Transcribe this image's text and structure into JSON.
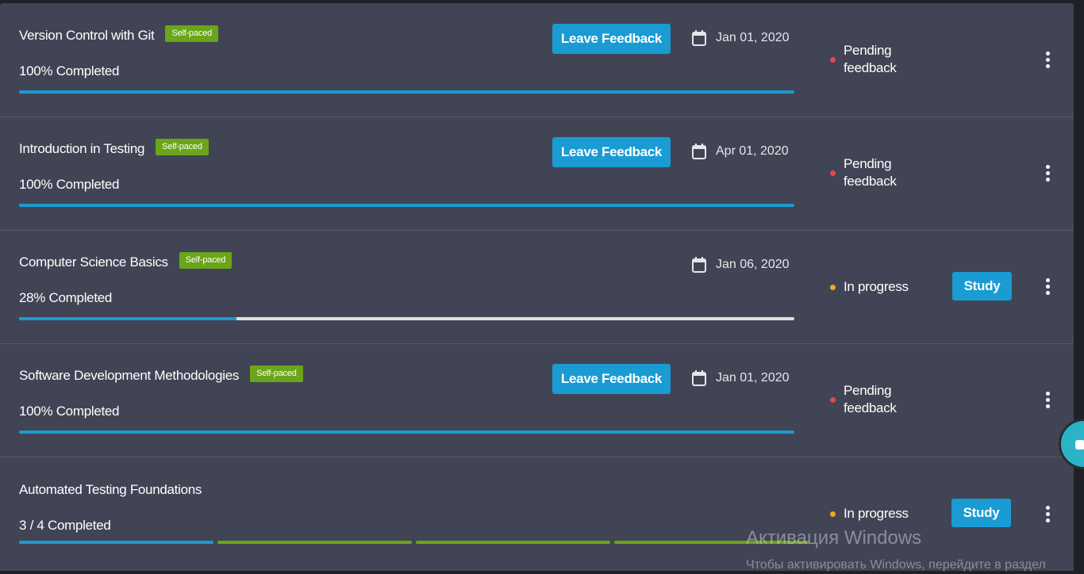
{
  "courses": [
    {
      "title": "Version Control with Git",
      "badge": "Self-paced",
      "progress_text": "100% Completed",
      "progress": 1.0,
      "action_label": "Leave Feedback",
      "date": "Jan 01, 2020",
      "status_line1": "Pending",
      "status_line2": "feedback",
      "status_color": "#e8474b"
    },
    {
      "title": "Introduction in Testing",
      "badge": "Self-paced",
      "progress_text": "100% Completed",
      "progress": 1.0,
      "action_label": "Leave Feedback",
      "date": "Apr 01, 2020",
      "status_line1": "Pending",
      "status_line2": "feedback",
      "status_color": "#e8474b"
    },
    {
      "title": "Computer Science Basics",
      "badge": "Self-paced",
      "progress_text": "28% Completed",
      "progress": 0.28,
      "action_label": "Study",
      "date": "Jan 06, 2020",
      "status_line1": "In progress",
      "status_color": "#f5a623"
    },
    {
      "title": "Software Development Methodologies",
      "badge": "Self-paced",
      "progress_text": "100% Completed",
      "progress": 1.0,
      "action_label": "Leave Feedback",
      "date": "Jan 01, 2020",
      "status_line1": "Pending",
      "status_line2": "feedback",
      "status_color": "#e8474b"
    },
    {
      "title": "Automated Testing Foundations",
      "progress_text": "3 / 4 Completed",
      "segments": [
        "#1b9bd1",
        "#6aa51a",
        "#6aa51a",
        "#6aa51a"
      ],
      "action_label": "Study",
      "status_line1": "In progress",
      "status_color": "#f5a623"
    }
  ],
  "icons": {
    "calendar": "calendar-icon",
    "menu": "more-vertical-icon",
    "chat": "chat-widget-icon"
  },
  "colors": {
    "accent": "#1a9bd3",
    "badge": "#6aa51a",
    "row_background": "#414454",
    "pending": "#e8474b",
    "in_progress": "#f5a623"
  },
  "watermark": {
    "title": "Активация Windows",
    "subtitle": "Чтобы активировать Windows, перейдите в раздел"
  }
}
